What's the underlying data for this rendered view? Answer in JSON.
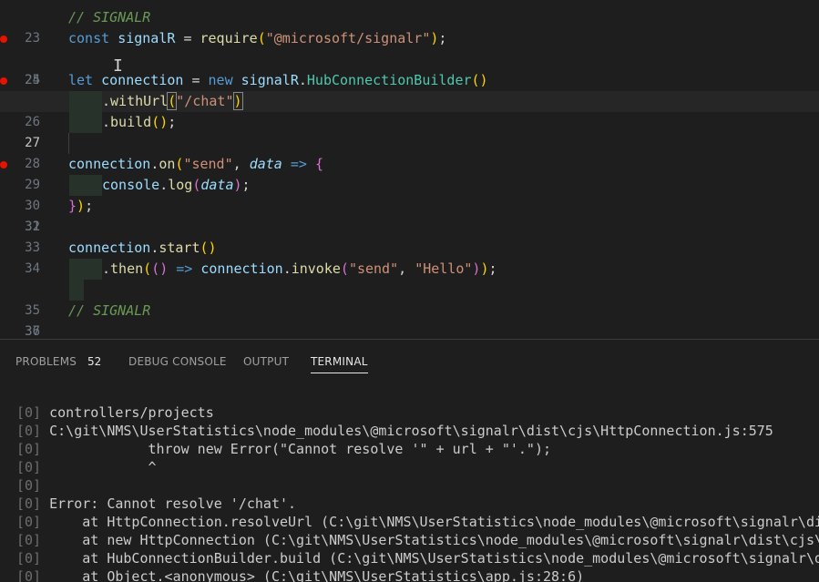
{
  "editor": {
    "lines": [
      {
        "n": "23",
        "text": "// SIGNALR"
      },
      {
        "n": "24",
        "text": "const signalR = require(\"@microsoft/signalr\");"
      },
      {
        "n": "25",
        "text": ""
      },
      {
        "n": "26",
        "text": "let connection = new signalR.HubConnectionBuilder()"
      },
      {
        "n": "27",
        "text": ".withUrl(\"/chat\")"
      },
      {
        "n": "28",
        "text": ".build();"
      },
      {
        "n": "29",
        "text": ""
      },
      {
        "n": "30",
        "text": "connection.on(\"send\", data => {"
      },
      {
        "n": "31",
        "text": "console.log(data);"
      },
      {
        "n": "32",
        "text": "});"
      },
      {
        "n": "33",
        "text": ""
      },
      {
        "n": "34",
        "text": "connection.start()"
      },
      {
        "n": "35",
        "text": ".then(() => connection.invoke(\"send\", \"Hello\"));"
      },
      {
        "n": "36",
        "text": ""
      },
      {
        "n": "37",
        "text": "// SIGNALR"
      },
      {
        "n": "38",
        "text": ""
      }
    ],
    "breakpoints": [
      "24",
      "26",
      "30"
    ],
    "current_line": "27"
  },
  "panel": {
    "tabs": [
      {
        "label": "PROBLEMS"
      },
      {
        "label": "DEBUG CONSOLE"
      },
      {
        "label": "OUTPUT"
      },
      {
        "label": "TERMINAL"
      }
    ],
    "problems_count": "52",
    "active_tab": "TERMINAL"
  },
  "terminal": {
    "prefix": "[0]",
    "lines": [
      "controllers/projects",
      "C:\\git\\NMS\\UserStatistics\\node_modules\\@microsoft\\signalr\\dist\\cjs\\HttpConnection.js:575",
      "            throw new Error(\"Cannot resolve '\" + url + \"'.\");",
      "            ^",
      "",
      "Error: Cannot resolve '/chat'.",
      "    at HttpConnection.resolveUrl (C:\\git\\NMS\\UserStatistics\\node_modules\\@microsoft\\signalr\\dist\\cjs\\HttpConnection.js:575:19)",
      "    at new HttpConnection (C:\\git\\NMS\\UserStatistics\\node_modules\\@microsoft\\signalr\\dist\\cjs\\HttpConnection.js:66:25)",
      "    at HubConnectionBuilder.build (C:\\git\\NMS\\UserStatistics\\node_modules\\@microsoft\\signalr\\dist\\cjs\\HubConnectionBuilder.js:99:32)",
      "    at Object.<anonymous> (C:\\git\\NMS\\UserStatistics\\app.js:28:6)"
    ]
  }
}
